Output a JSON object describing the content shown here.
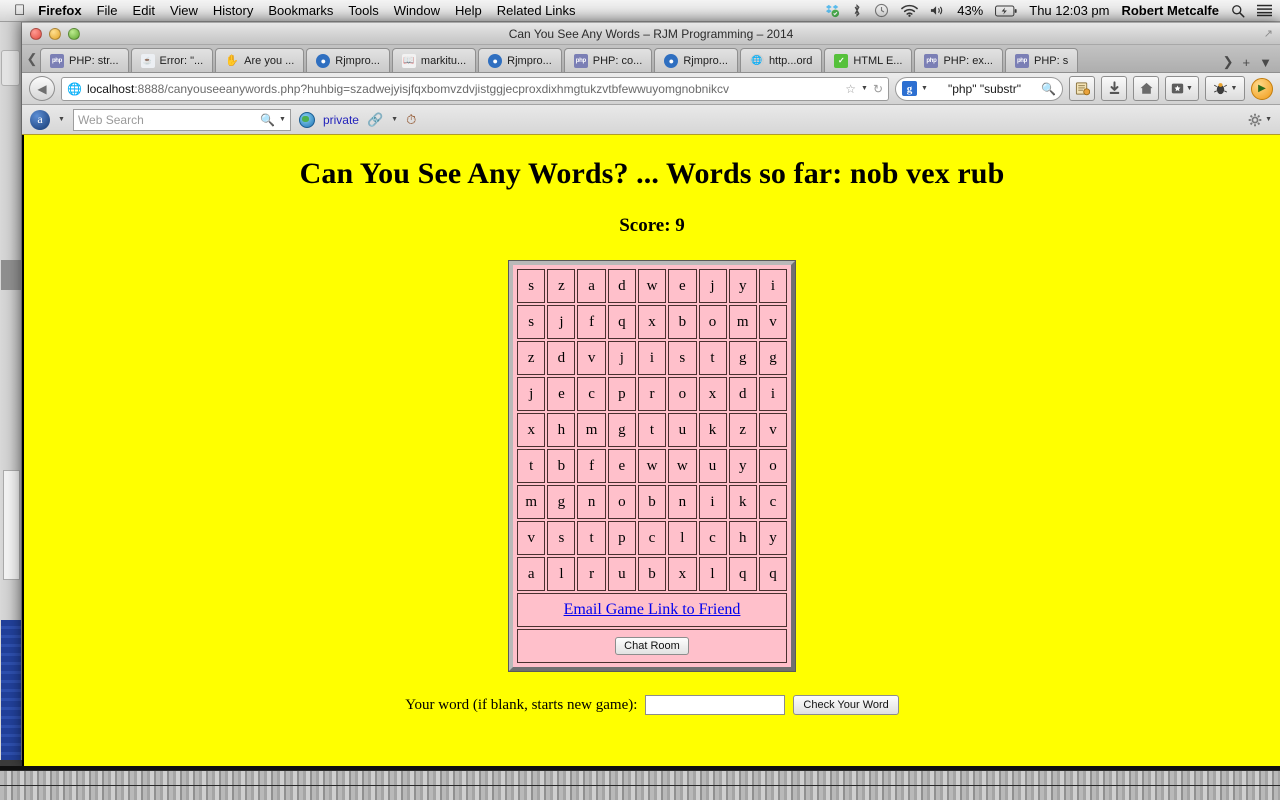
{
  "menubar": {
    "apple_icon": "apple-icon",
    "items": [
      "Firefox",
      "File",
      "Edit",
      "View",
      "History",
      "Bookmarks",
      "Tools",
      "Window",
      "Help",
      "Related Links"
    ],
    "status_icons": [
      "dropbox-icon",
      "bluetooth-icon",
      "timemachine-icon",
      "wifi-icon",
      "volume-icon"
    ],
    "battery_pct": "43%",
    "battery_icon": "battery-charging-icon",
    "clock": "Thu 12:03 pm",
    "user": "Robert Metcalfe",
    "spotlight_icon": "search-icon",
    "notifications_icon": "notification-center-icon"
  },
  "window": {
    "title": "Can You See Any Words – RJM Programming – 2014",
    "resize_icon": "resize-icon"
  },
  "tabs": {
    "scroll_left_icon": "chevron-left-icon",
    "scroll_right_icon": "chevron-right-icon",
    "new_tab_icon": "plus-icon",
    "list_all_icon": "chevron-down-icon",
    "items": [
      {
        "label": "PHP: str...",
        "icon": "php-icon"
      },
      {
        "label": "Error: \"...",
        "icon": "java-icon"
      },
      {
        "label": "Are you ...",
        "icon": "hand-icon"
      },
      {
        "label": "Rjmpro...",
        "icon": "rjm-icon"
      },
      {
        "label": "markitu...",
        "icon": "book-icon"
      },
      {
        "label": "Rjmpro...",
        "icon": "rjm-icon"
      },
      {
        "label": "PHP: co...",
        "icon": "php-icon"
      },
      {
        "label": "Rjmpro...",
        "icon": "rjm-icon"
      },
      {
        "label": "http...ord",
        "icon": "globe-icon"
      },
      {
        "label": "HTML E...",
        "icon": "html-icon"
      },
      {
        "label": "PHP: ex...",
        "icon": "php-icon"
      },
      {
        "label": "PHP: s",
        "icon": "php-icon"
      }
    ]
  },
  "navbar": {
    "back_icon": "back-arrow-icon",
    "url_host": "localhost",
    "url_rest": ":8888/canyouseeanywords.php?huhbig=szadwejyisjfqxbomvzdvjistggjecproxdixhmgtukzvtbfewwuyomgnobnikcv",
    "bookmark_star_icon": "star-icon",
    "url_dropdown_icon": "chevron-down-icon",
    "reload_icon": "reload-icon",
    "search_engine_letter": "g",
    "search_engine_icon": "google-icon",
    "search_query": "\"php\" \"substr\"",
    "search_go_icon": "search-icon",
    "buttons": [
      {
        "name": "readability-button",
        "icon": "readability-icon"
      },
      {
        "name": "downloads-button",
        "icon": "download-arrow-icon"
      },
      {
        "name": "home-button",
        "icon": "home-icon"
      },
      {
        "name": "bookmarks-button",
        "icon": "bookmark-star-icon"
      },
      {
        "name": "firebug-button",
        "icon": "firebug-bug-icon"
      }
    ],
    "addon_icon": "play-orb-icon"
  },
  "searchtoolbar": {
    "provider_icon": "a-orb-icon",
    "provider_dropdown_icon": "chevron-down-icon",
    "search_placeholder": "Web Search",
    "search_value": "",
    "search_icon": "search-icon",
    "search_dropdown_icon": "chevron-down-icon",
    "globe_icon": "globe-icon",
    "private_label": "private",
    "link_icon": "link-icon",
    "link_dropdown_icon": "chevron-down-icon",
    "stamp_icon": "stamp-icon",
    "gear_icon": "gear-icon",
    "gear_dropdown_icon": "chevron-down-icon"
  },
  "page": {
    "background_color": "#ffff00",
    "heading": "Can You See Any Words? ... Words so far: nob vex rub",
    "score": "Score: 9",
    "grid": {
      "cell_color": "#ffc0cb",
      "rows": [
        [
          "s",
          "z",
          "a",
          "d",
          "w",
          "e",
          "j",
          "y",
          "i"
        ],
        [
          "s",
          "j",
          "f",
          "q",
          "x",
          "b",
          "o",
          "m",
          "v"
        ],
        [
          "z",
          "d",
          "v",
          "j",
          "i",
          "s",
          "t",
          "g",
          "g"
        ],
        [
          "j",
          "e",
          "c",
          "p",
          "r",
          "o",
          "x",
          "d",
          "i"
        ],
        [
          "x",
          "h",
          "m",
          "g",
          "t",
          "u",
          "k",
          "z",
          "v"
        ],
        [
          "t",
          "b",
          "f",
          "e",
          "w",
          "w",
          "u",
          "y",
          "o"
        ],
        [
          "m",
          "g",
          "n",
          "o",
          "b",
          "n",
          "i",
          "k",
          "c"
        ],
        [
          "v",
          "s",
          "t",
          "p",
          "c",
          "l",
          "c",
          "h",
          "y"
        ],
        [
          "a",
          "l",
          "r",
          "u",
          "b",
          "x",
          "l",
          "q",
          "q"
        ]
      ]
    },
    "email_link": "Email Game Link to Friend",
    "chat_button": "Chat Room",
    "form_label": "Your word (if blank, starts new game):",
    "word_value": "",
    "word_placeholder": "",
    "check_button": "Check Your Word"
  }
}
